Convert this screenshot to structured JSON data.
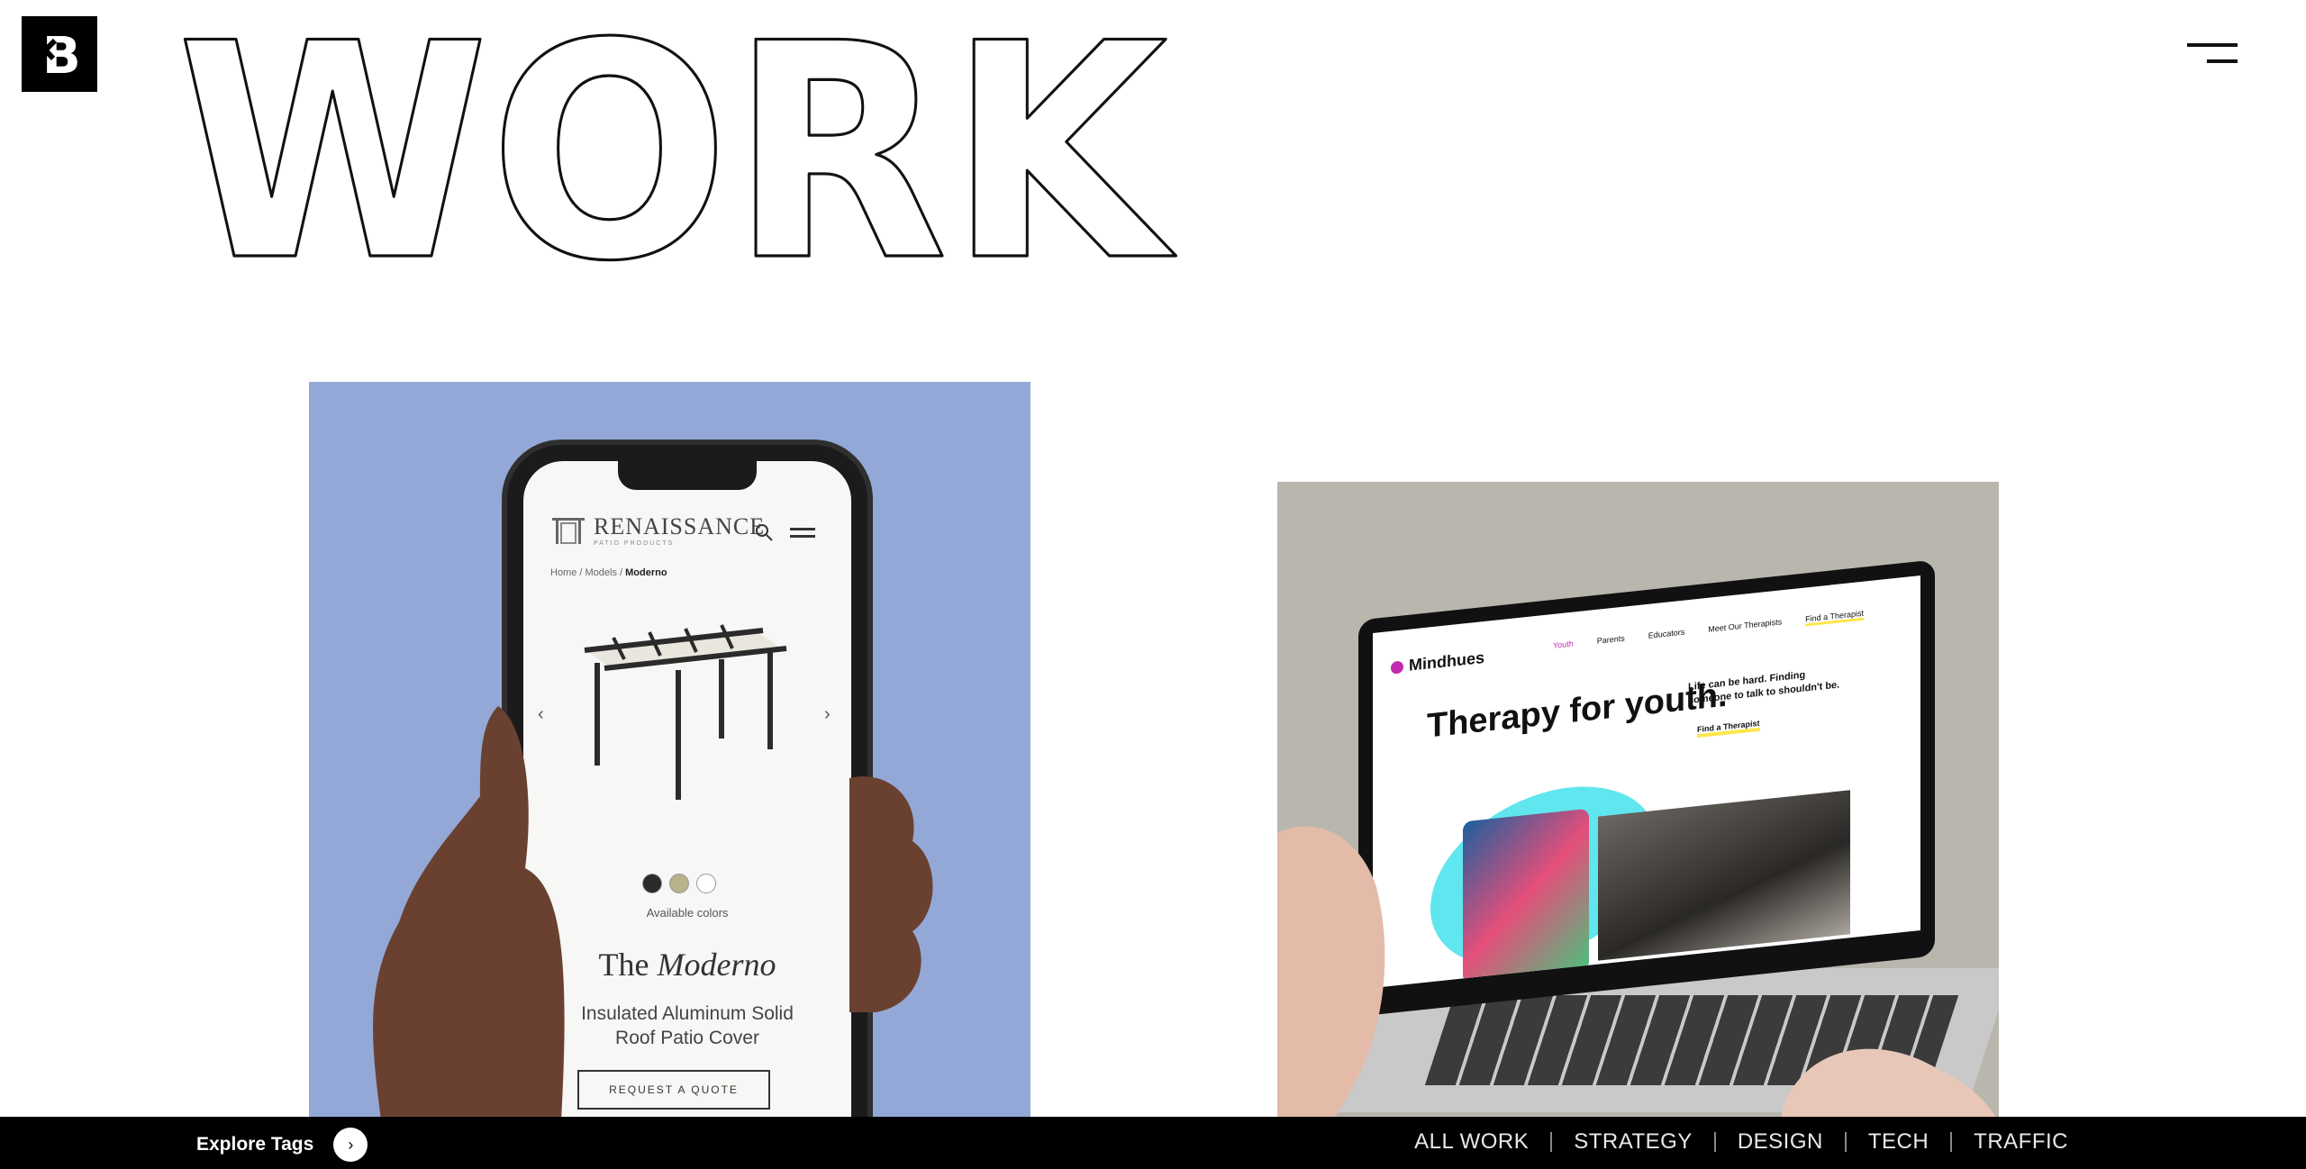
{
  "header": {
    "title": "WORK",
    "logo_letter": "B",
    "menu_icon": "hamburger-icon"
  },
  "projects": [
    {
      "name": "Renaissance Patio Products",
      "screen": {
        "brand": "RENAISSANCE",
        "brand_sub": "PATIO PRODUCTS",
        "breadcrumb_home": "Home / Models / ",
        "breadcrumb_current": "Moderno",
        "colors_label": "Available colors",
        "title_prefix": "The ",
        "title_model": "Moderno",
        "description": "Insulated Aluminum Solid Roof Patio Cover",
        "cta": "REQUEST A QUOTE",
        "swatch_colors": [
          "#2a2a2a",
          "#b9b28a",
          "#ffffff"
        ]
      }
    },
    {
      "name": "Mindhues",
      "screen": {
        "brand": "Mindhues",
        "nav": [
          "Youth",
          "Parents",
          "Educators",
          "Meet Our Therapists",
          "Find a Therapist"
        ],
        "headline": "Therapy for youth.",
        "subtext": "Life can be hard. Finding someone to talk to shouldn't be.",
        "cta": "Find a Therapist",
        "accent": "#c02bb0"
      }
    }
  ],
  "footer": {
    "explore_label": "Explore Tags",
    "tags": [
      "ALL WORK",
      "STRATEGY",
      "DESIGN",
      "TECH",
      "TRAFFIC"
    ]
  }
}
